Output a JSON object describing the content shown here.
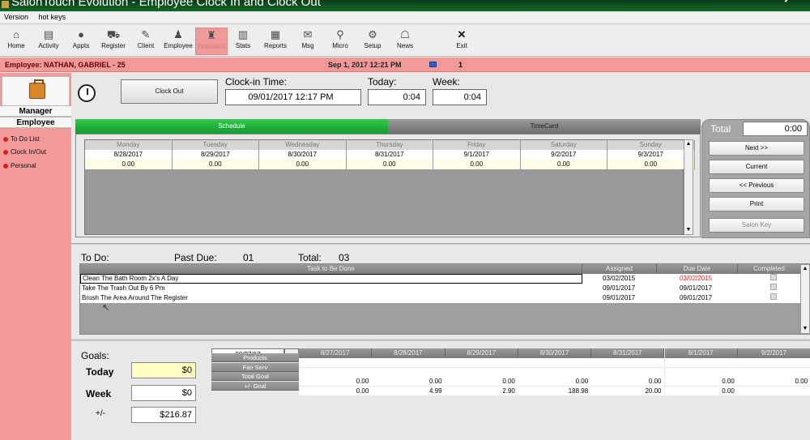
{
  "window": {
    "title": "SalonTouch Evolution - Employee Clock In and Clock Out"
  },
  "menu": [
    "Version",
    "hot keys"
  ],
  "toolbar": [
    {
      "label": "Home",
      "icon": "home-icon"
    },
    {
      "label": "Activity",
      "icon": "activity-icon"
    },
    {
      "label": "Appts",
      "icon": "appointments-icon"
    },
    {
      "label": "Register",
      "icon": "cart-icon"
    },
    {
      "label": "Client",
      "icon": "client-icon"
    },
    {
      "label": "Employee",
      "icon": "employee-icon"
    },
    {
      "label": "Timeclock",
      "icon": "timeclock-icon"
    },
    {
      "label": "Stats",
      "icon": "stats-icon"
    },
    {
      "label": "Reports",
      "icon": "reports-icon"
    },
    {
      "label": "Msg",
      "icon": "message-icon"
    },
    {
      "label": "Micro",
      "icon": "micro-icon"
    },
    {
      "label": "Setup",
      "icon": "setup-icon"
    },
    {
      "label": "News",
      "icon": "news-icon"
    },
    {
      "label": "Exit",
      "icon": "close-icon"
    }
  ],
  "header": {
    "employee": "Employee: NATHAN, GABRIEL - 25",
    "datetime": "Sep  1,  2017   12:21 PM",
    "count": "1"
  },
  "sidebar": {
    "manager": "Manager",
    "employee": "Employee",
    "items": [
      "To Do List",
      "Clock In/Out",
      "Personal"
    ]
  },
  "clock": {
    "button": "Clock Out",
    "clockin_label": "Clock-in Time:",
    "clockin_value": "09/01/2017 12:17 PM",
    "today_label": "Today:",
    "today_value": "0:04",
    "week_label": "Week:",
    "week_value": "0:04"
  },
  "tabs": {
    "schedule": "Schedule",
    "timecard": "TimeCard"
  },
  "schedule": {
    "days": [
      "Monday",
      "Tuesday",
      "Wednesday",
      "Thursday",
      "Friday",
      "Saturday",
      "Sunday"
    ],
    "dates": [
      "8/28/2017",
      "8/29/2017",
      "8/30/2017",
      "8/31/2017",
      "9/1/2017",
      "9/2/2017",
      "9/3/2017"
    ],
    "hours": [
      "0.00",
      "0.00",
      "0.00",
      "0.00",
      "0.00",
      "0.00",
      "0.00"
    ]
  },
  "right_panel": {
    "total_label": "Total",
    "total_value": "0:00",
    "next": "Next >>",
    "current": "Current",
    "previous": "<< Previous",
    "print": "Print",
    "salon_key": "Salon Key"
  },
  "todo": {
    "label": "To Do:",
    "past_due_label": "Past Due:",
    "past_due_value": "01",
    "total_label": "Total:",
    "total_value": "03",
    "columns": [
      "Task to Be Done",
      "Assigned",
      "Due Date",
      "Completed"
    ],
    "rows": [
      {
        "task": "Clean The Bath Room 2x's A Day",
        "assigned": "03/02/2015",
        "due": "03/02/2015"
      },
      {
        "task": "Take The Trash Out By 6 Pm",
        "assigned": "09/01/2017",
        "due": "09/01/2017"
      },
      {
        "task": "Brush The Area Around The Register",
        "assigned": "09/01/2017",
        "due": "09/01/2017"
      }
    ]
  },
  "goals": {
    "label": "Goals:",
    "today_label": "Today",
    "today_value": "$0",
    "week_label": "Week",
    "week_value": "$0",
    "plusminus_label": "+/-",
    "plusminus_value": "$216.87",
    "date_value": "08/27/17",
    "date_button": "...",
    "columns": [
      "8/27/2017",
      "8/28/2017",
      "8/29/2017",
      "8/30/2017",
      "8/31/2017",
      "9/1/2017",
      "9/2/2017"
    ],
    "row_labels": [
      "Products",
      "Fan Serv",
      "Total Goal",
      "+/- Goal"
    ],
    "total_goal": [
      "0.00",
      "0.00",
      "0.00",
      "0.00",
      "0.00",
      "0.00",
      "0.00"
    ],
    "plusminus_goal": [
      "0.00",
      "4.99",
      "2.90",
      "188.98",
      "20.00",
      "0.00",
      ""
    ]
  },
  "colors": {
    "accent_green": "#139a2c",
    "employee_bar": "#f19898",
    "sidebar": "#f29a9a",
    "overdue": "#e02020"
  }
}
